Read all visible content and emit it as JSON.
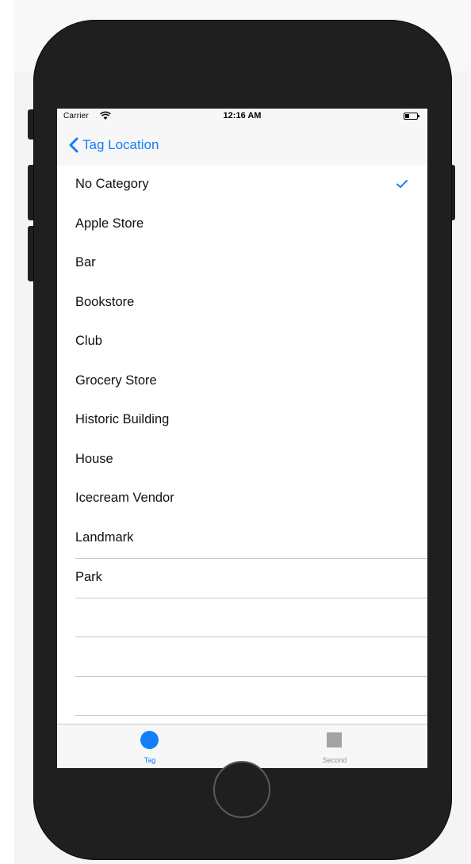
{
  "status_bar": {
    "carrier": "Carrier",
    "time": "12:16 AM"
  },
  "nav": {
    "back_label": "Tag Location"
  },
  "categories": [
    {
      "label": "No Category",
      "selected": true
    },
    {
      "label": "Apple Store",
      "selected": false
    },
    {
      "label": "Bar",
      "selected": false
    },
    {
      "label": "Bookstore",
      "selected": false
    },
    {
      "label": "Club",
      "selected": false
    },
    {
      "label": "Grocery Store",
      "selected": false
    },
    {
      "label": "Historic Building",
      "selected": false
    },
    {
      "label": "House",
      "selected": false
    },
    {
      "label": "Icecream Vendor",
      "selected": false
    },
    {
      "label": "Landmark",
      "selected": false
    },
    {
      "label": "Park",
      "selected": false
    }
  ],
  "tab_bar": {
    "tabs": [
      {
        "label": "Tag",
        "icon": "circle-icon",
        "active": true
      },
      {
        "label": "Second",
        "icon": "square-icon",
        "active": false
      }
    ]
  },
  "colors": {
    "accent": "#147efb",
    "inactive": "#a3a3a3"
  }
}
